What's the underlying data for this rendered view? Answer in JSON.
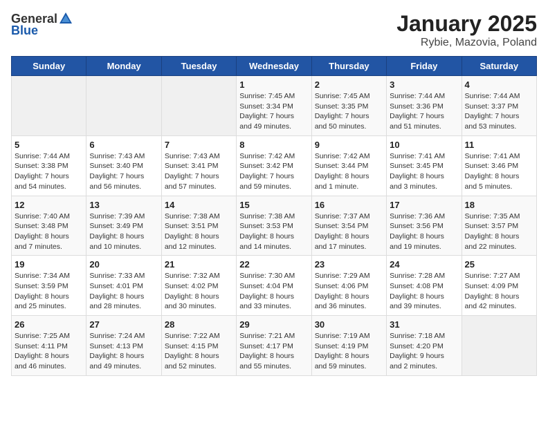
{
  "header": {
    "logo_general": "General",
    "logo_blue": "Blue",
    "title": "January 2025",
    "subtitle": "Rybie, Mazovia, Poland"
  },
  "weekdays": [
    "Sunday",
    "Monday",
    "Tuesday",
    "Wednesday",
    "Thursday",
    "Friday",
    "Saturday"
  ],
  "weeks": [
    [
      {
        "day": "",
        "info": ""
      },
      {
        "day": "",
        "info": ""
      },
      {
        "day": "",
        "info": ""
      },
      {
        "day": "1",
        "info": "Sunrise: 7:45 AM\nSunset: 3:34 PM\nDaylight: 7 hours\nand 49 minutes."
      },
      {
        "day": "2",
        "info": "Sunrise: 7:45 AM\nSunset: 3:35 PM\nDaylight: 7 hours\nand 50 minutes."
      },
      {
        "day": "3",
        "info": "Sunrise: 7:44 AM\nSunset: 3:36 PM\nDaylight: 7 hours\nand 51 minutes."
      },
      {
        "day": "4",
        "info": "Sunrise: 7:44 AM\nSunset: 3:37 PM\nDaylight: 7 hours\nand 53 minutes."
      }
    ],
    [
      {
        "day": "5",
        "info": "Sunrise: 7:44 AM\nSunset: 3:38 PM\nDaylight: 7 hours\nand 54 minutes."
      },
      {
        "day": "6",
        "info": "Sunrise: 7:43 AM\nSunset: 3:40 PM\nDaylight: 7 hours\nand 56 minutes."
      },
      {
        "day": "7",
        "info": "Sunrise: 7:43 AM\nSunset: 3:41 PM\nDaylight: 7 hours\nand 57 minutes."
      },
      {
        "day": "8",
        "info": "Sunrise: 7:42 AM\nSunset: 3:42 PM\nDaylight: 7 hours\nand 59 minutes."
      },
      {
        "day": "9",
        "info": "Sunrise: 7:42 AM\nSunset: 3:44 PM\nDaylight: 8 hours\nand 1 minute."
      },
      {
        "day": "10",
        "info": "Sunrise: 7:41 AM\nSunset: 3:45 PM\nDaylight: 8 hours\nand 3 minutes."
      },
      {
        "day": "11",
        "info": "Sunrise: 7:41 AM\nSunset: 3:46 PM\nDaylight: 8 hours\nand 5 minutes."
      }
    ],
    [
      {
        "day": "12",
        "info": "Sunrise: 7:40 AM\nSunset: 3:48 PM\nDaylight: 8 hours\nand 7 minutes."
      },
      {
        "day": "13",
        "info": "Sunrise: 7:39 AM\nSunset: 3:49 PM\nDaylight: 8 hours\nand 10 minutes."
      },
      {
        "day": "14",
        "info": "Sunrise: 7:38 AM\nSunset: 3:51 PM\nDaylight: 8 hours\nand 12 minutes."
      },
      {
        "day": "15",
        "info": "Sunrise: 7:38 AM\nSunset: 3:53 PM\nDaylight: 8 hours\nand 14 minutes."
      },
      {
        "day": "16",
        "info": "Sunrise: 7:37 AM\nSunset: 3:54 PM\nDaylight: 8 hours\nand 17 minutes."
      },
      {
        "day": "17",
        "info": "Sunrise: 7:36 AM\nSunset: 3:56 PM\nDaylight: 8 hours\nand 19 minutes."
      },
      {
        "day": "18",
        "info": "Sunrise: 7:35 AM\nSunset: 3:57 PM\nDaylight: 8 hours\nand 22 minutes."
      }
    ],
    [
      {
        "day": "19",
        "info": "Sunrise: 7:34 AM\nSunset: 3:59 PM\nDaylight: 8 hours\nand 25 minutes."
      },
      {
        "day": "20",
        "info": "Sunrise: 7:33 AM\nSunset: 4:01 PM\nDaylight: 8 hours\nand 28 minutes."
      },
      {
        "day": "21",
        "info": "Sunrise: 7:32 AM\nSunset: 4:02 PM\nDaylight: 8 hours\nand 30 minutes."
      },
      {
        "day": "22",
        "info": "Sunrise: 7:30 AM\nSunset: 4:04 PM\nDaylight: 8 hours\nand 33 minutes."
      },
      {
        "day": "23",
        "info": "Sunrise: 7:29 AM\nSunset: 4:06 PM\nDaylight: 8 hours\nand 36 minutes."
      },
      {
        "day": "24",
        "info": "Sunrise: 7:28 AM\nSunset: 4:08 PM\nDaylight: 8 hours\nand 39 minutes."
      },
      {
        "day": "25",
        "info": "Sunrise: 7:27 AM\nSunset: 4:09 PM\nDaylight: 8 hours\nand 42 minutes."
      }
    ],
    [
      {
        "day": "26",
        "info": "Sunrise: 7:25 AM\nSunset: 4:11 PM\nDaylight: 8 hours\nand 46 minutes."
      },
      {
        "day": "27",
        "info": "Sunrise: 7:24 AM\nSunset: 4:13 PM\nDaylight: 8 hours\nand 49 minutes."
      },
      {
        "day": "28",
        "info": "Sunrise: 7:22 AM\nSunset: 4:15 PM\nDaylight: 8 hours\nand 52 minutes."
      },
      {
        "day": "29",
        "info": "Sunrise: 7:21 AM\nSunset: 4:17 PM\nDaylight: 8 hours\nand 55 minutes."
      },
      {
        "day": "30",
        "info": "Sunrise: 7:19 AM\nSunset: 4:19 PM\nDaylight: 8 hours\nand 59 minutes."
      },
      {
        "day": "31",
        "info": "Sunrise: 7:18 AM\nSunset: 4:20 PM\nDaylight: 9 hours\nand 2 minutes."
      },
      {
        "day": "",
        "info": ""
      }
    ]
  ]
}
